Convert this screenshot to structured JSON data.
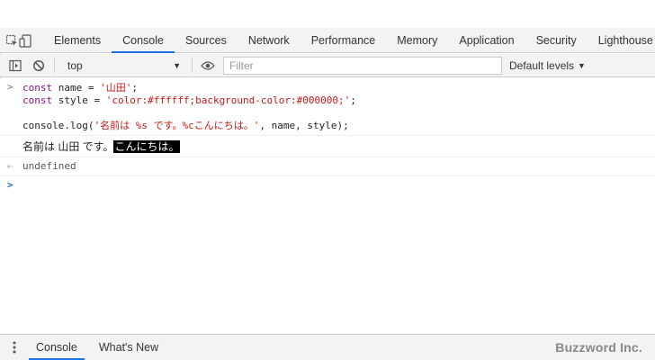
{
  "tabs": [
    "Elements",
    "Console",
    "Sources",
    "Network",
    "Performance",
    "Memory",
    "Application",
    "Security",
    "Lighthouse"
  ],
  "active_tab": "Console",
  "toolbar": {
    "context": "top",
    "filter_placeholder": "Filter",
    "levels": "Default levels"
  },
  "console": {
    "line1_kw": "const",
    "line1_rest": " name = ",
    "line1_str": "'山田'",
    "line1_end": ";",
    "line2_kw": "const",
    "line2_rest": " style = ",
    "line2_str": "'color:#ffffff;background-color:#000000;'",
    "line2_end": ";",
    "line3_pre": "console.log(",
    "line3_str": "'名前は %s です。%cこんにちは。'",
    "line3_post": ", name, style);",
    "output_plain": "名前は 山田 です。",
    "output_styled": "こんにちは。",
    "result": "undefined"
  },
  "drawer": {
    "tabs": [
      "Console",
      "What's New"
    ],
    "watermark": "Buzzword Inc."
  },
  "colors": {
    "accent": "#1a73e8",
    "keyword": "#881280",
    "string": "#c41a16",
    "styled_fg": "#ffffff",
    "styled_bg": "#000000"
  }
}
